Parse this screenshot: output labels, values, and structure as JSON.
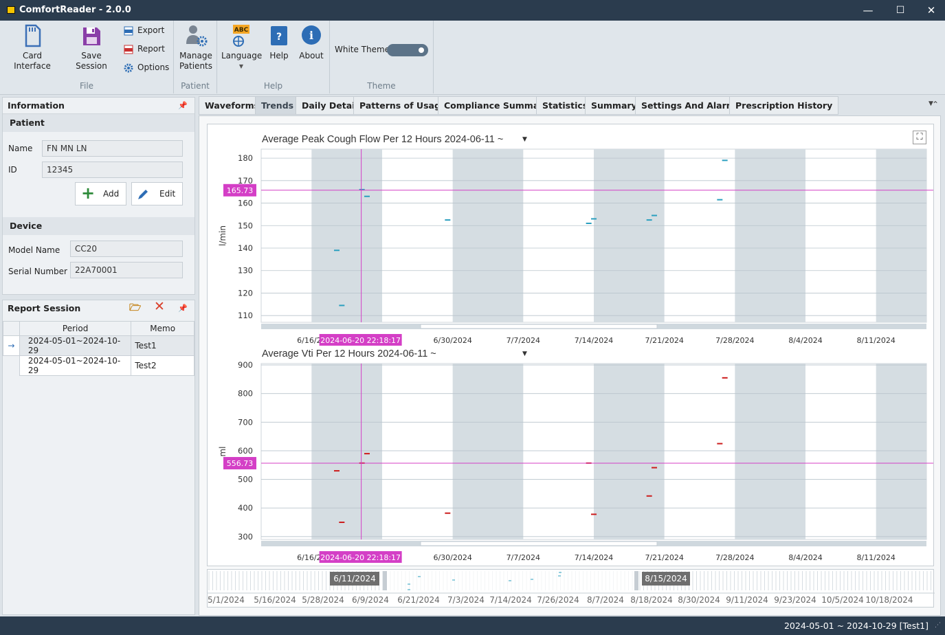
{
  "app": {
    "icon": "app-icon",
    "title": "ComfortReader - 2.0.0"
  },
  "window": {
    "minimize": "—",
    "maximize": "☐",
    "close": "✕"
  },
  "ribbon": {
    "file": {
      "group_label": "File",
      "card_interface": "Card Interface",
      "save_session": "Save Session",
      "export": "Export",
      "report": "Report",
      "options": "Options"
    },
    "patient": {
      "group_label": "Patient",
      "manage_patients_line1": "Manage",
      "manage_patients_line2": "Patients"
    },
    "help": {
      "group_label": "Help",
      "language": "Language",
      "language_badge": "ABC",
      "help": "Help",
      "about": "About"
    },
    "theme": {
      "group_label": "Theme",
      "white_theme": "White Theme",
      "white_theme_on": true
    }
  },
  "information": {
    "title": "Information",
    "patient_section": "Patient",
    "name_label": "Name",
    "name_value": "FN MN LN",
    "id_label": "ID",
    "id_value": "12345",
    "add_label": "Add",
    "edit_label": "Edit",
    "device_section": "Device",
    "model_label": "Model Name",
    "model_value": "CC20",
    "serial_label": "Serial Number",
    "serial_value": "22A70001"
  },
  "report_session": {
    "title": "Report Session",
    "columns": [
      "Period",
      "Memo"
    ],
    "rows": [
      {
        "period": "2024-05-01~2024-10-29",
        "memo": "Test1",
        "selected": true,
        "marker": "→"
      },
      {
        "period": "2024-05-01~2024-10-29",
        "memo": "Test2",
        "selected": false,
        "marker": ""
      }
    ]
  },
  "tabs": [
    {
      "label": "Waveforms",
      "active": false
    },
    {
      "label": "Trends",
      "active": true
    },
    {
      "label": "Daily Detail",
      "active": false
    },
    {
      "label": "Patterns of Usage",
      "active": false
    },
    {
      "label": "Compliance Summary",
      "active": false
    },
    {
      "label": "Statistics",
      "active": false
    },
    {
      "label": "Summary",
      "active": false
    },
    {
      "label": "Settings And Alarms",
      "active": false
    },
    {
      "label": "Prescription History",
      "active": false
    }
  ],
  "chart_data": [
    {
      "type": "scatter",
      "title": "Average Peak Cough Flow Per 12 Hours 2024-06-11 ~",
      "ylabel": "l/min",
      "xlabel": "",
      "ylim": [
        107,
        184
      ],
      "yticks": [
        110,
        120,
        130,
        140,
        150,
        160,
        170,
        180
      ],
      "xlim": [
        "2024-06-11",
        "2024-08-16"
      ],
      "xticks": [
        "6/16/20",
        "6/30/2024",
        "7/7/2024",
        "7/14/2024",
        "7/21/2024",
        "7/28/2024",
        "8/4/2024",
        "8/11/2024"
      ],
      "xtick_dates": [
        "2024-06-16",
        "2024-06-30",
        "2024-07-07",
        "2024-07-14",
        "2024-07-21",
        "2024-07-28",
        "2024-08-04",
        "2024-08-11"
      ],
      "shaded_week_starts": [
        "2024-06-16",
        "2024-06-30",
        "2024-07-14",
        "2024-07-28",
        "2024-08-11"
      ],
      "crosshair": {
        "x": "2024-06-20 22:18:17",
        "y": 165.73,
        "x_label": "2024-06-20 22:18:17",
        "y_label": "165.73"
      },
      "series": [
        {
          "color": "#2a9fbf",
          "points": [
            {
              "x": "2024-06-18 12:00",
              "y": 139
            },
            {
              "x": "2024-06-18 24:00",
              "y": 114.5
            },
            {
              "x": "2024-06-20 24:00",
              "y": 166
            },
            {
              "x": "2024-06-21 12:00",
              "y": 163
            },
            {
              "x": "2024-06-29 12:00",
              "y": 152.5
            },
            {
              "x": "2024-07-13 12:00",
              "y": 151
            },
            {
              "x": "2024-07-13 24:00",
              "y": 153
            },
            {
              "x": "2024-07-19 12:00",
              "y": 152.5
            },
            {
              "x": "2024-07-19 24:00",
              "y": 154.5
            },
            {
              "x": "2024-07-26 12:00",
              "y": 161.5
            },
            {
              "x": "2024-07-26 24:00",
              "y": 179
            }
          ]
        }
      ]
    },
    {
      "type": "scatter",
      "title": "Average Vti Per 12 Hours 2024-06-11 ~",
      "ylabel": "ml",
      "xlabel": "",
      "ylim": [
        290,
        905
      ],
      "yticks": [
        300,
        400,
        500,
        600,
        700,
        800,
        900
      ],
      "xlim": [
        "2024-06-11",
        "2024-08-16"
      ],
      "xticks": [
        "6/16/20",
        "6/30/2024",
        "7/7/2024",
        "7/14/2024",
        "7/21/2024",
        "7/28/2024",
        "8/4/2024",
        "8/11/2024"
      ],
      "xtick_dates": [
        "2024-06-16",
        "2024-06-30",
        "2024-07-07",
        "2024-07-14",
        "2024-07-21",
        "2024-07-28",
        "2024-08-04",
        "2024-08-11"
      ],
      "shaded_week_starts": [
        "2024-06-16",
        "2024-06-30",
        "2024-07-14",
        "2024-07-28",
        "2024-08-11"
      ],
      "crosshair": {
        "x": "2024-06-20 22:18:17",
        "y": 556.73,
        "x_label": "2024-06-20 22:18:17",
        "y_label": "556.73"
      },
      "series": [
        {
          "color": "#cc1b1b",
          "points": [
            {
              "x": "2024-06-18 12:00",
              "y": 530
            },
            {
              "x": "2024-06-18 24:00",
              "y": 350
            },
            {
              "x": "2024-06-20 24:00",
              "y": 557
            },
            {
              "x": "2024-06-21 12:00",
              "y": 590
            },
            {
              "x": "2024-06-29 12:00",
              "y": 382
            },
            {
              "x": "2024-07-13 12:00",
              "y": 557
            },
            {
              "x": "2024-07-13 24:00",
              "y": 378
            },
            {
              "x": "2024-07-19 12:00",
              "y": 442
            },
            {
              "x": "2024-07-19 24:00",
              "y": 541
            },
            {
              "x": "2024-07-26 12:00",
              "y": 625
            },
            {
              "x": "2024-07-26 24:00",
              "y": 855
            }
          ]
        }
      ]
    }
  ],
  "navigator": {
    "range_start": "6/11/2024",
    "range_end": "8/15/2024",
    "labels": [
      "5/1/2024",
      "5/16/2024",
      "5/28/2024",
      "6/9/2024",
      "6/21/2024",
      "7/3/2024",
      "7/14/2024",
      "7/26/2024",
      "8/7/2024",
      "8/18/2024",
      "8/30/2024",
      "9/11/2024",
      "9/23/2024",
      "10/5/2024",
      "10/18/2024"
    ]
  },
  "status": {
    "text": "2024-05-01 ~ 2024-10-29 [Test1]"
  },
  "colors": {
    "titlebar": "#2b3c4e",
    "crosshair": "#d43fc6",
    "pcf_series": "#2a9fbf",
    "vti_series": "#cc1b1b",
    "shade": "#d5dde2"
  }
}
